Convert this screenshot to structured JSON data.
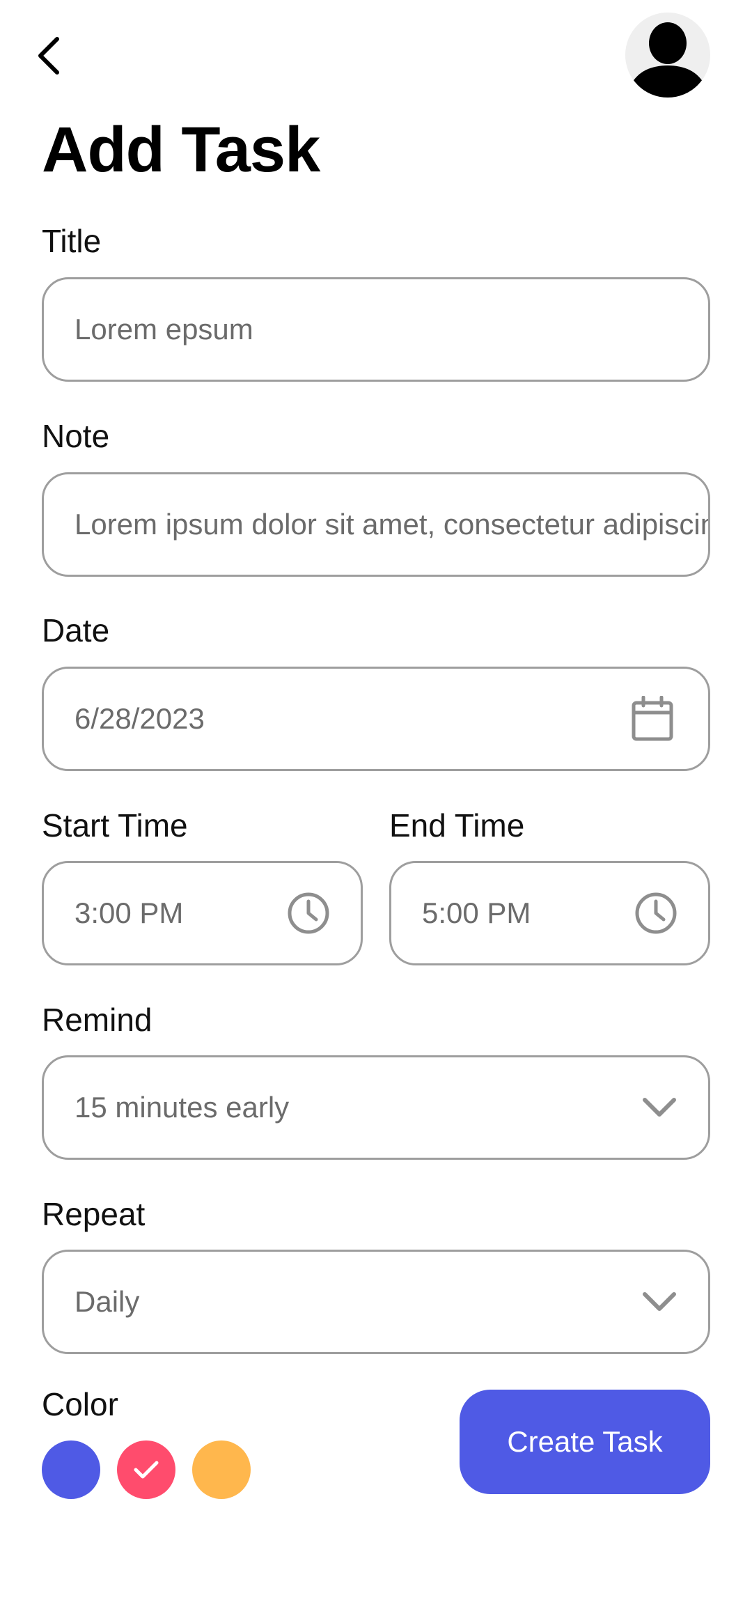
{
  "header": {
    "back_icon": "chevron-left-icon",
    "avatar_icon": "user-avatar-icon",
    "title": "Add Task"
  },
  "form": {
    "title": {
      "label": "Title",
      "value": "Lorem epsum"
    },
    "note": {
      "label": "Note",
      "value": "Lorem ipsum dolor sit amet, consectetur adipiscing elit"
    },
    "date": {
      "label": "Date",
      "value": "6/28/2023",
      "icon": "calendar-icon"
    },
    "start_time": {
      "label": "Start Time",
      "value": "3:00 PM",
      "icon": "clock-icon"
    },
    "end_time": {
      "label": "End Time",
      "value": "5:00 PM",
      "icon": "clock-icon"
    },
    "remind": {
      "label": "Remind",
      "value": "15 minutes early",
      "icon": "chevron-down-icon"
    },
    "repeat": {
      "label": "Repeat",
      "value": "Daily",
      "icon": "chevron-down-icon"
    },
    "color": {
      "label": "Color",
      "options": [
        {
          "name": "blue",
          "hex": "#4f5ae5",
          "selected": false
        },
        {
          "name": "pink",
          "hex": "#ff4c6d",
          "selected": true
        },
        {
          "name": "orange",
          "hex": "#ffb74d",
          "selected": false
        }
      ]
    }
  },
  "actions": {
    "create_label": "Create Task"
  },
  "colors": {
    "accent": "#4f5ae5",
    "border": "#9e9e9e",
    "placeholder_text": "#6b6b6b",
    "icon_gray": "#8e8e8e"
  }
}
